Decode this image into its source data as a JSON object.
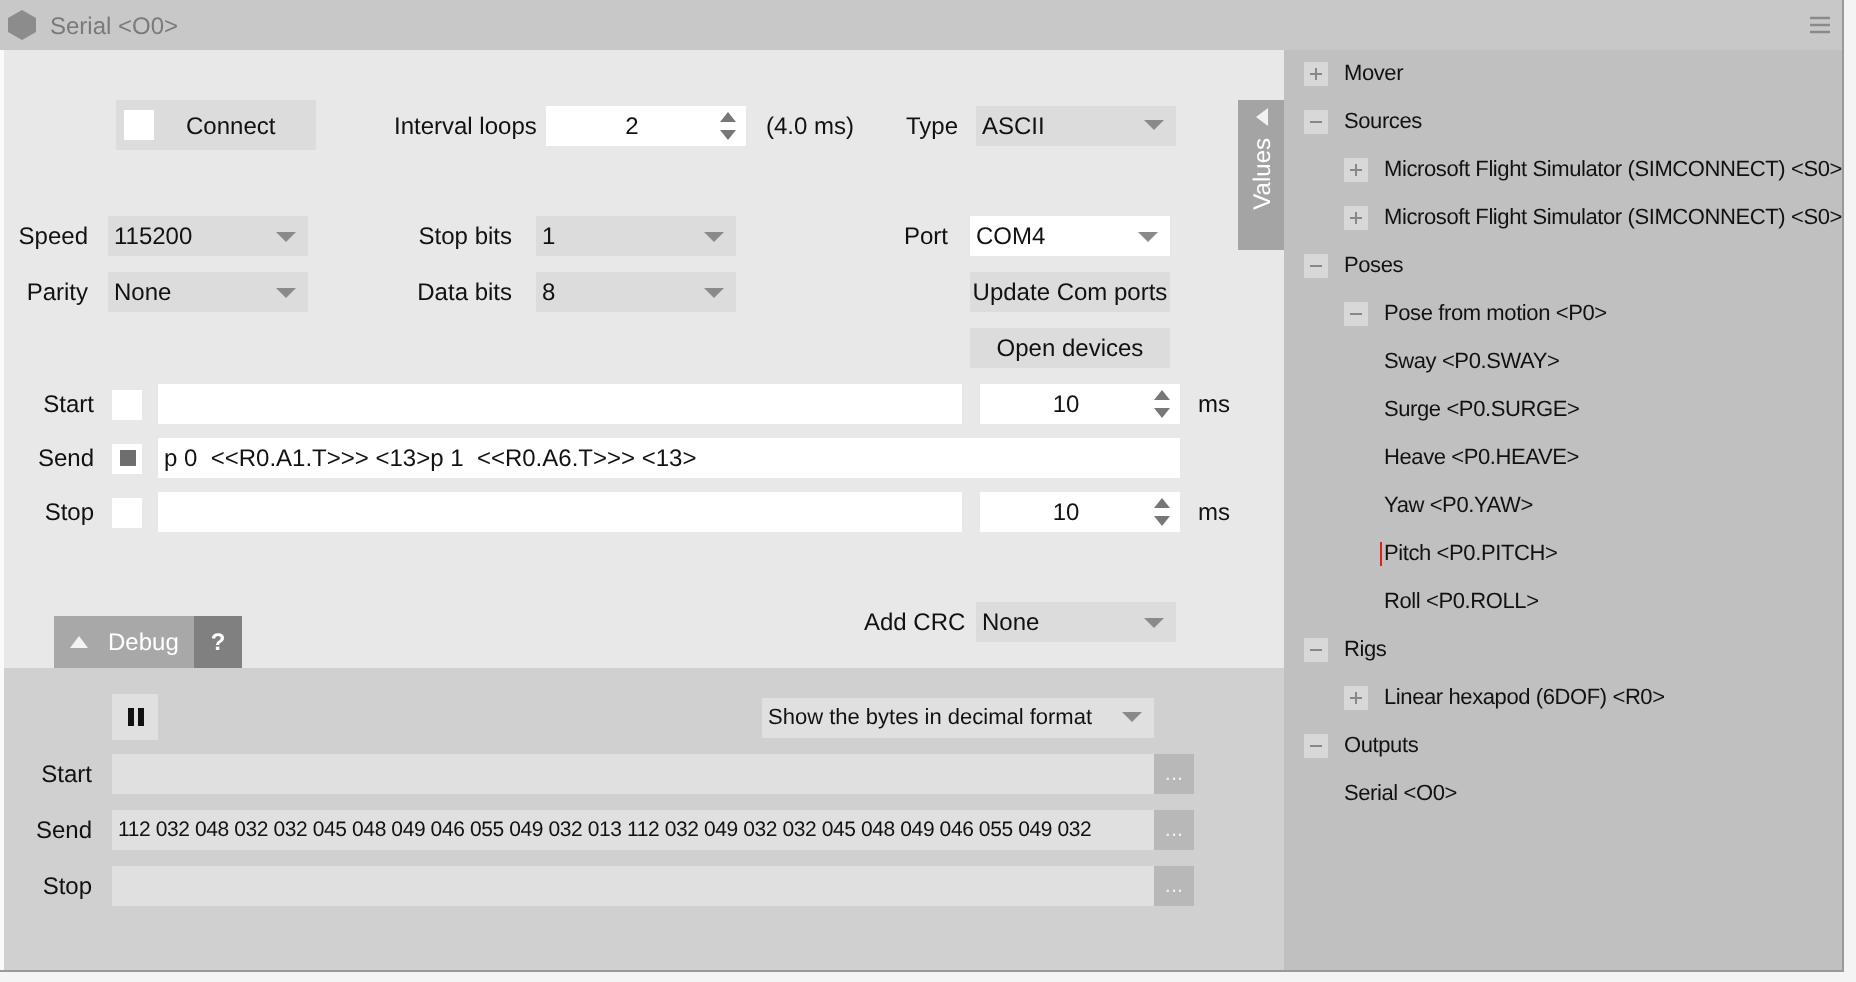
{
  "window": {
    "title": "Serial <O0>"
  },
  "connect": {
    "label": "Connect",
    "checked": false
  },
  "interval": {
    "label": "Interval loops",
    "value": "2",
    "reading": "(4.0 ms)"
  },
  "type": {
    "label": "Type",
    "value": "ASCII"
  },
  "speed": {
    "label": "Speed",
    "value": "115200"
  },
  "stop_bits": {
    "label": "Stop bits",
    "value": "1"
  },
  "port": {
    "label": "Port",
    "value": "COM4",
    "editable": true
  },
  "parity": {
    "label": "Parity",
    "value": "None"
  },
  "data_bits": {
    "label": "Data bits",
    "value": "8"
  },
  "buttons": [
    "Update Com ports",
    "Open devices"
  ],
  "commands": [
    {
      "label": "Start",
      "checked": false,
      "delay": "10",
      "unit": "ms"
    },
    {
      "label": "Send",
      "checked": true,
      "value": "p 0  <<R0.A1.T>>> <13>p 1  <<R0.A6.T>>> <13>"
    },
    {
      "label": "Stop",
      "checked": false,
      "delay": "10",
      "unit": "ms"
    }
  ],
  "debug_tab": {
    "label": "Debug",
    "help": "?"
  },
  "add_crc": {
    "label": "Add CRC",
    "value": "None"
  },
  "debug": {
    "format": "Show the bytes in decimal format",
    "rows": [
      {
        "label": "Start",
        "more": "..."
      },
      {
        "label": "Send",
        "value": "112 032 048 032 032 045 048 049 046 055 049 032 013 112 032 049 032 032 045 048 049 046 055 049 032",
        "more": "..."
      },
      {
        "label": "Stop",
        "more": "..."
      }
    ]
  },
  "values_tab": {
    "label": "Values"
  },
  "tree": [
    {
      "label": "Mover",
      "expanded": false,
      "selected": false
    },
    {
      "label": "Sources",
      "expanded": true,
      "selected": false,
      "children": [
        {
          "label": "Microsoft Flight Simulator (SIMCONNECT) <S0>",
          "expanded": false,
          "selected": false
        },
        {
          "label": "Microsoft Flight Simulator (SIMCONNECT) <S0>",
          "expanded": false,
          "selected": false
        }
      ]
    },
    {
      "label": "Poses",
      "expanded": true,
      "selected": false,
      "children": [
        {
          "label": "Pose from motion <P0>",
          "expanded": true,
          "selected": false,
          "children": [
            {
              "label": "Sway <P0.SWAY>",
              "selected": false
            },
            {
              "label": "Surge <P0.SURGE>",
              "selected": false
            },
            {
              "label": "Heave <P0.HEAVE>",
              "selected": false
            },
            {
              "label": "Yaw <P0.YAW>",
              "selected": false
            },
            {
              "label": "Pitch <P0.PITCH>",
              "selected": true
            },
            {
              "label": "Roll <P0.ROLL>",
              "selected": false
            }
          ]
        }
      ]
    },
    {
      "label": "Rigs",
      "expanded": true,
      "selected": false,
      "children": [
        {
          "label": "Linear hexapod (6DOF) <R0>",
          "expanded": false,
          "selected": false
        }
      ]
    },
    {
      "label": "Outputs",
      "expanded": true,
      "selected": false,
      "children": [
        {
          "label": "Serial <O0>",
          "selected": false
        }
      ]
    }
  ]
}
